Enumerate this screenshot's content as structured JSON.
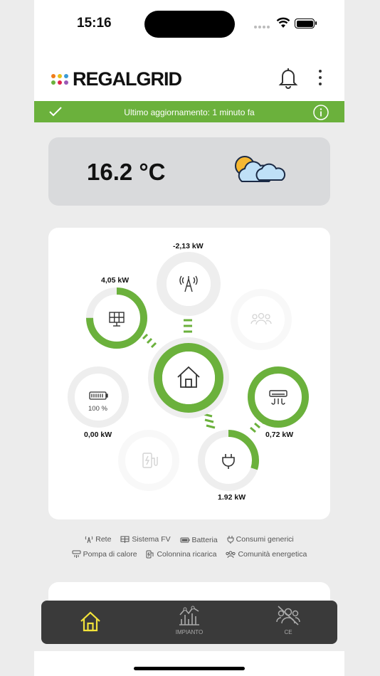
{
  "status": {
    "time": "15:16"
  },
  "header": {
    "brand": "REGALGRID",
    "logo_dot_colors": [
      "#f07d1a",
      "#e6c21a",
      "#3a9bd5",
      "#6bb13c",
      "#e0234e",
      "#9b59b6"
    ]
  },
  "banner": {
    "text": "Ultimo aggiornamento: 1 minuto fa",
    "color": "#6bb13c"
  },
  "weather": {
    "temperature": "16.2 °C",
    "icon": "partly-cloudy-icon"
  },
  "energy_flow": {
    "accent": "#6bb13c",
    "grid": {
      "value": "-2,13 kW",
      "level": 0
    },
    "solar": {
      "value": "4,05 kW",
      "level": 0.75
    },
    "community": {
      "active": false
    },
    "house": {
      "level": 1.0
    },
    "battery": {
      "value": "0,00 kW",
      "percent": "100 %",
      "level": 0
    },
    "heat_pump": {
      "value": "0,72 kW",
      "level": 1.0
    },
    "charger": {
      "active": false
    },
    "consumption": {
      "value": "1.92 kW",
      "level": 0.3
    }
  },
  "legend": {
    "row1": [
      "Rete",
      "Sistema FV",
      "Batteria",
      "Consumi generici"
    ],
    "row2": [
      "Pompa di calore",
      "Colonnina ricarica",
      "Comunità energetica"
    ]
  },
  "tabbar": {
    "active_color": "#f2e33a",
    "tabs": [
      {
        "label": "",
        "icon": "home-icon",
        "active": true
      },
      {
        "label": "IMPIANTO",
        "icon": "chart-icon",
        "active": false
      },
      {
        "label": "CE",
        "icon": "community-off-icon",
        "active": false
      }
    ]
  }
}
